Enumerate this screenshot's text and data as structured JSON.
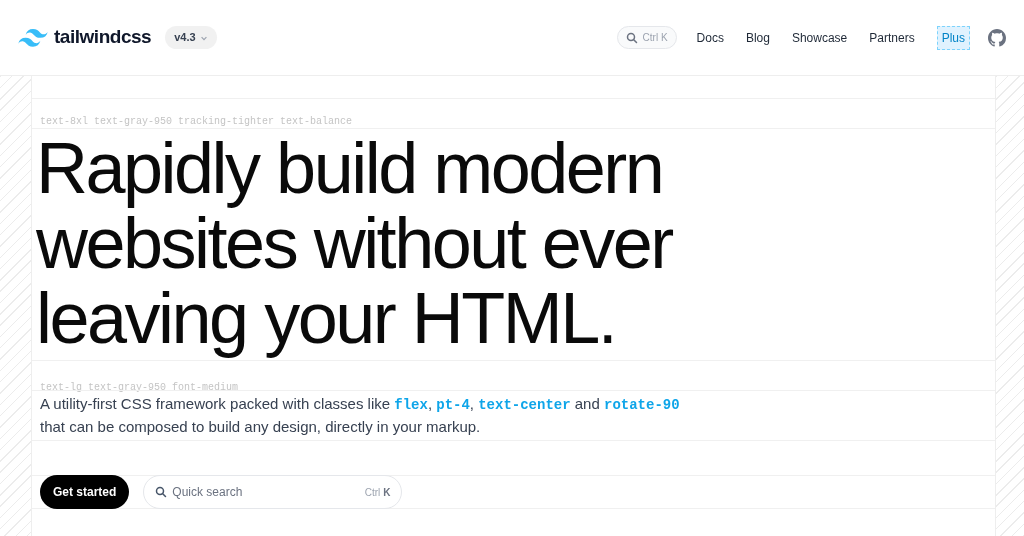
{
  "header": {
    "logo": "tailwindcss",
    "version": "v4.3",
    "search_shortcut": "Ctrl K",
    "nav": [
      {
        "label": "Docs",
        "highlighted": false
      },
      {
        "label": "Blog",
        "highlighted": false
      },
      {
        "label": "Showcase",
        "highlighted": false
      },
      {
        "label": "Partners",
        "highlighted": false
      },
      {
        "label": "Plus",
        "highlighted": true
      }
    ]
  },
  "headline_label": "text-8xl text-gray-950 tracking-tighter text-balance",
  "headline": [
    "Rapidly build modern",
    "websites without ever",
    "leaving your HTML."
  ],
  "description_label": "text-lg text-gray-950 font-medium",
  "description": [
    {
      "kind": "text",
      "text": "A utility-first CSS framework packed with classes like "
    },
    {
      "kind": "code",
      "text": "flex"
    },
    {
      "kind": "text",
      "text": ", "
    },
    {
      "kind": "code",
      "text": "pt-4"
    },
    {
      "kind": "text",
      "text": ", "
    },
    {
      "kind": "code",
      "text": "text-center"
    },
    {
      "kind": "text",
      "text": " and "
    },
    {
      "kind": "code",
      "text": "rotate-90"
    },
    {
      "kind": "text",
      "text": " that can be composed to build any design, directly in your markup."
    }
  ],
  "cta": {
    "label": "Get started"
  },
  "quick_search": {
    "placeholder": "Quick search",
    "shortcut_modifier": "Ctrl",
    "shortcut_key": "K"
  }
}
